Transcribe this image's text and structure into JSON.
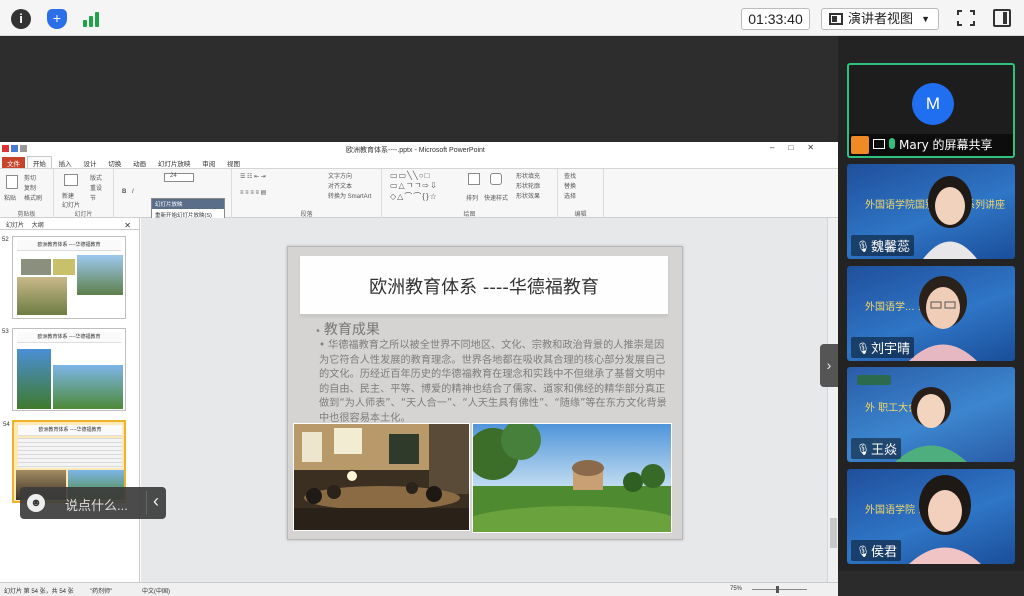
{
  "meeting": {
    "timer": "01:33:40",
    "view_mode": "演讲者视图"
  },
  "ppt": {
    "window_title": "欧洲教育体系----.pptx - Microsoft PowerPoint",
    "tabs": [
      "文件",
      "开始",
      "插入",
      "设计",
      "切换",
      "动画",
      "幻灯片放映",
      "审阅",
      "视图"
    ],
    "groups": {
      "clipboard": "剪贴板",
      "slides": "幻灯片",
      "paragraph": "段落",
      "drawing": "绘图",
      "editing": "编辑"
    },
    "ribbon_items": {
      "paste": "粘贴",
      "cut": "剪切",
      "copy": "复制",
      "format_painter": "格式刷",
      "new_slide": "新建\n幻灯片",
      "layout": "版式",
      "reset": "重设",
      "section": "节",
      "font_size": "24",
      "text_direction": "文字方向",
      "align_text": "对齐文本",
      "smartart": "转换为 SmartArt",
      "arrange": "排列",
      "quick_styles": "快速样式",
      "shape_fill": "形状填充",
      "shape_outline": "形状轮廓",
      "shape_effects": "形状效果",
      "find": "查找",
      "replace": "替换",
      "select": "选择"
    },
    "tooltip": {
      "title": "幻灯片放映",
      "body": "重新开始幻灯片放映(S)"
    },
    "pane_tabs": [
      "幻灯片",
      "大纲"
    ],
    "thumbnails": [
      {
        "num": "52",
        "title": "欧洲教育体系 ----华德福教育"
      },
      {
        "num": "53",
        "title": "欧洲教育体系 ----华德福教育"
      },
      {
        "num": "54",
        "title": "欧洲教育体系 ----华德福教育"
      }
    ],
    "slide": {
      "title": "欧洲教育体系 ----华德福教育",
      "bullet": "教育成果",
      "body": "华德福教育之所以被全世界不同地区、文化、宗教和政治背景的人推崇是因为它符合人性发展的教育理念。世界各地都在吸收其合理的核心部分发展自己的文化。历经近百年历史的华德福教育在理念和实践中不但继承了基督文明中的自由、民主、平等、博爱的精神也结合了儒家、道家和佛经的精华部分真正做到“为人师表”、“天人合一”、“人天生具有佛性”、“随缘”等在东方文化背景中也很容易本土化。"
    },
    "status": {
      "slide_pos": "幻灯片 第 54 张，共 54 张",
      "theme": "\"药剂师\"",
      "language": "中文(中国)",
      "zoom": "75%"
    }
  },
  "chat": {
    "placeholder": "说点什么..."
  },
  "participants": [
    {
      "name": "Mary 的屏幕共享",
      "avatar": "M",
      "kind": "screen-share"
    },
    {
      "name": "魏馨蕊",
      "banner": "外国语学院国别与文化系列讲座"
    },
    {
      "name": "刘宇晴",
      "banner": "外国语学...            系列讲座"
    },
    {
      "name": "王焱",
      "banner": "外               职工大会"
    },
    {
      "name": "侯君",
      "banner": "外国语学院              系列讲座"
    }
  ],
  "colors": {
    "accent_green": "#2ec27e",
    "avatar_blue": "#1f6ff0",
    "ppt_file_tab": "#c7442b",
    "selected_thumb": "#f0b229"
  }
}
